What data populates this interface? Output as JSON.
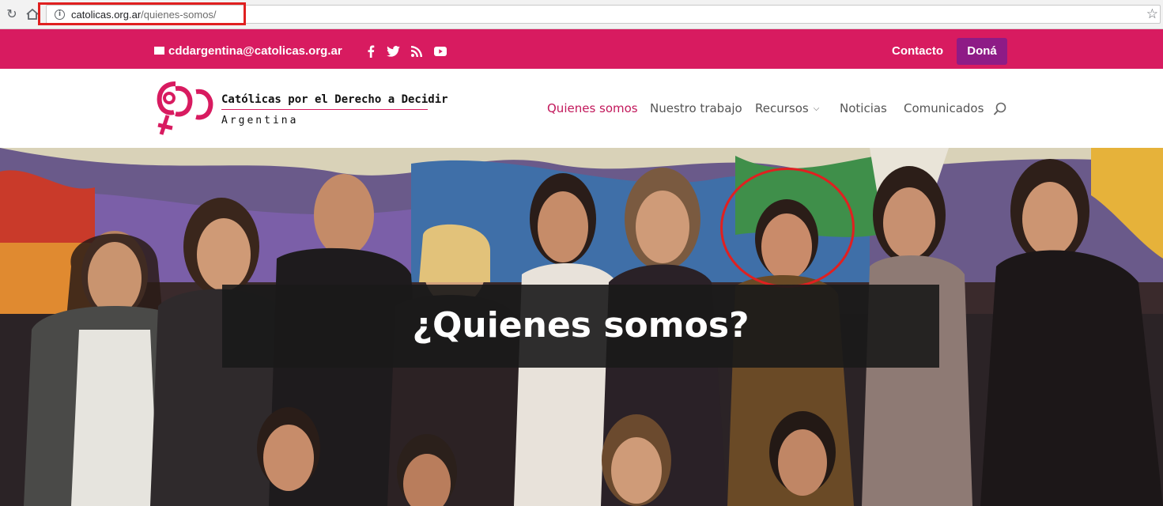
{
  "browser": {
    "url_domain": "catolicas.org.ar",
    "url_path": "/quienes-somos/",
    "icons": [
      "reload-icon",
      "home-icon",
      "info-icon",
      "star-icon"
    ]
  },
  "topbar": {
    "email": "cddargentina@catolicas.org.ar",
    "social_icons": [
      "facebook-icon",
      "twitter-icon",
      "rss-icon",
      "youtube-icon"
    ],
    "contact_label": "Contacto",
    "donate_label": "Doná",
    "background_color": "#d81b60",
    "donate_color": "#8e1b86"
  },
  "header": {
    "brand_name": "Católicas por el Derecho a Decidir",
    "brand_country": "Argentina",
    "menu": [
      {
        "label": "Quienes somos",
        "active": true
      },
      {
        "label": "Nuestro trabajo",
        "active": false
      },
      {
        "label": "Recursos",
        "active": false,
        "has_dropdown": true
      },
      {
        "label": "Noticias",
        "active": false
      },
      {
        "label": "Comunicados",
        "active": false
      }
    ],
    "accent_color": "#c2185b"
  },
  "hero": {
    "title": "¿Quienes somos?",
    "image_description_icon": "group-photo"
  }
}
